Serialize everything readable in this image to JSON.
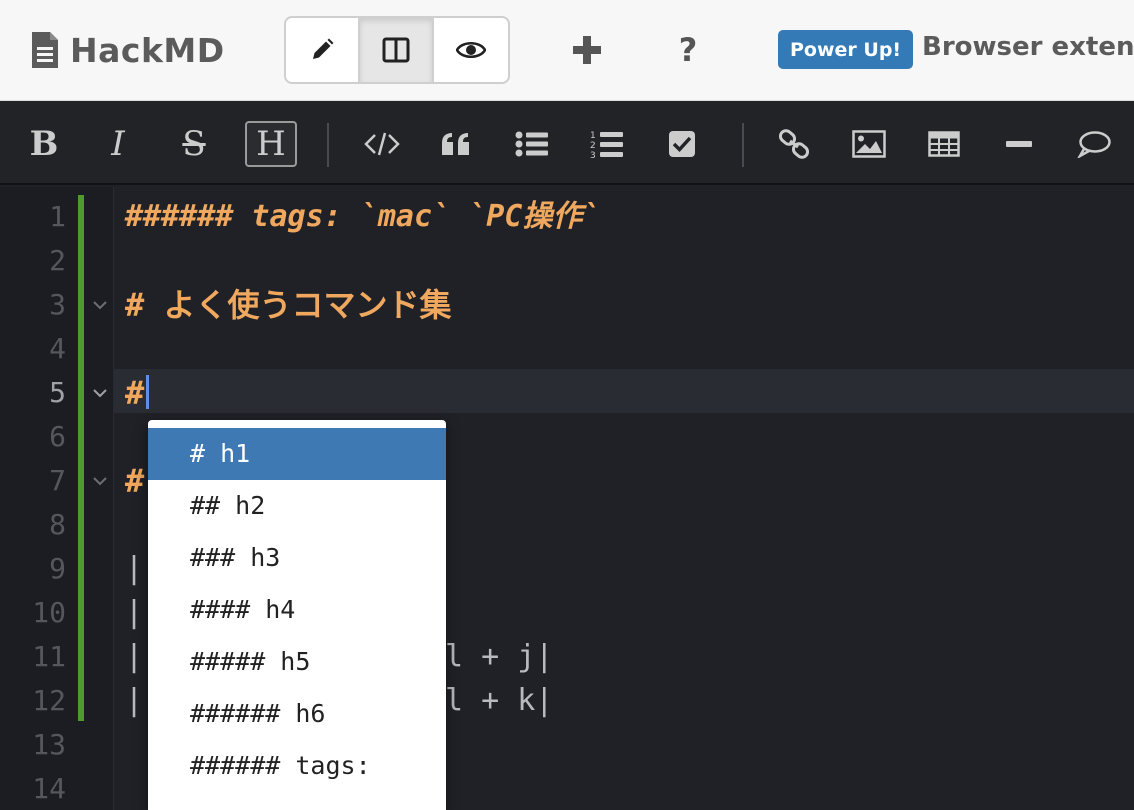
{
  "brand": {
    "name": "HackMD",
    "icon": "document-icon"
  },
  "view_modes": [
    {
      "name": "edit",
      "icon": "pencil-icon",
      "active": false
    },
    {
      "name": "both",
      "icon": "columns-icon",
      "active": true
    },
    {
      "name": "view",
      "icon": "eye-icon",
      "active": false
    }
  ],
  "nav_actions": {
    "new": "plus-icon",
    "help": "?"
  },
  "promo": {
    "badge": "Power Up!",
    "text": "Browser extensi"
  },
  "toolbar": {
    "bold": "B",
    "italic": "I",
    "strike": "S",
    "heading": "H",
    "icons": [
      "bold-icon",
      "italic-icon",
      "strikethrough-icon",
      "heading-icon",
      "code-icon",
      "quote-icon",
      "unordered-list-icon",
      "ordered-list-icon",
      "checkbox-icon",
      "link-icon",
      "image-icon",
      "table-icon",
      "horizontal-rule-icon",
      "comment-icon"
    ]
  },
  "editor": {
    "line_numbers": [
      "1",
      "2",
      "3",
      "4",
      "5",
      "6",
      "7",
      "8",
      "9",
      "10",
      "11",
      "12",
      "13",
      "14"
    ],
    "active_line": 5,
    "lines": {
      "l1": "###### tags: `mac` `PC操作`",
      "l3": "# よく使うコマンド集",
      "l5": "#",
      "l7": "#",
      "l9": "|",
      "l10": "|",
      "l11_left": "|",
      "l11_right": "l + j|",
      "l12_left": "|",
      "l12_right": "l + k|"
    }
  },
  "autocomplete": {
    "selected_index": 0,
    "items": [
      "# h1",
      "## h2",
      "### h3",
      "#### h4",
      "##### h5",
      "###### h6",
      "###### tags:"
    ]
  },
  "colors": {
    "accent": "#337ab7",
    "selection": "#3f79b4",
    "header_text": "#f0a85e",
    "git_change_bar": "#4e9a2e",
    "editor_bg": "#202127"
  }
}
